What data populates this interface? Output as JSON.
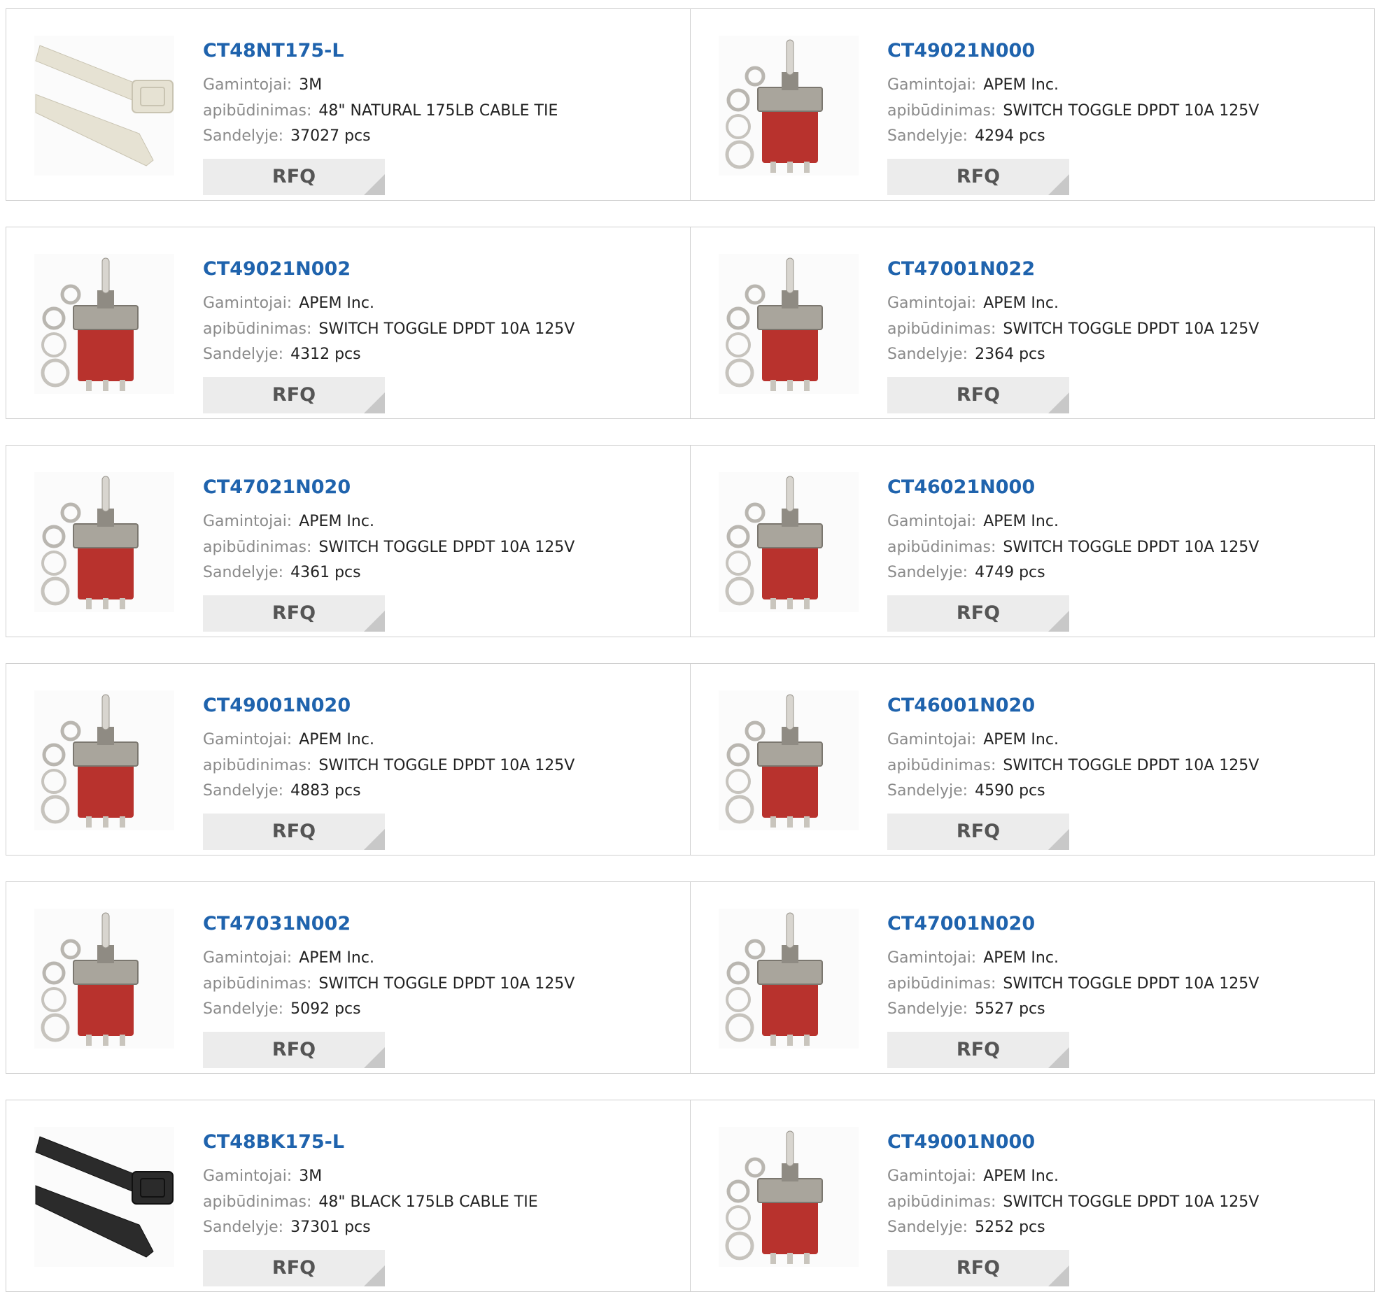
{
  "labels": {
    "manufacturer": "Gamintojai:",
    "description": "apibūdinimas:",
    "stock": "Sandelyje:",
    "rfq": "RFQ"
  },
  "colors": {
    "part_link": "#1f63ad",
    "label": "#8a8a8a",
    "value": "#222222",
    "rfq_bg": "#ececec",
    "rfq_text": "#555555"
  },
  "products": [
    {
      "part": "CT48NT175-L",
      "manufacturer": "3M",
      "description": "48\" NATURAL 175LB CABLE TIE",
      "stock": "37027 pcs",
      "image": "natural-cable-tie-image"
    },
    {
      "part": "CT49021N000",
      "manufacturer": "APEM Inc.",
      "description": "SWITCH TOGGLE DPDT 10A 125V",
      "stock": "4294 pcs",
      "image": "toggle-switch-image"
    },
    {
      "part": "CT49021N002",
      "manufacturer": "APEM Inc.",
      "description": "SWITCH TOGGLE DPDT 10A 125V",
      "stock": "4312 pcs",
      "image": "toggle-switch-image"
    },
    {
      "part": "CT47001N022",
      "manufacturer": "APEM Inc.",
      "description": "SWITCH TOGGLE DPDT 10A 125V",
      "stock": "2364 pcs",
      "image": "toggle-switch-image"
    },
    {
      "part": "CT47021N020",
      "manufacturer": "APEM Inc.",
      "description": "SWITCH TOGGLE DPDT 10A 125V",
      "stock": "4361 pcs",
      "image": "toggle-switch-image"
    },
    {
      "part": "CT46021N000",
      "manufacturer": "APEM Inc.",
      "description": "SWITCH TOGGLE DPDT 10A 125V",
      "stock": "4749 pcs",
      "image": "toggle-switch-image"
    },
    {
      "part": "CT49001N020",
      "manufacturer": "APEM Inc.",
      "description": "SWITCH TOGGLE DPDT 10A 125V",
      "stock": "4883 pcs",
      "image": "toggle-switch-image"
    },
    {
      "part": "CT46001N020",
      "manufacturer": "APEM Inc.",
      "description": "SWITCH TOGGLE DPDT 10A 125V",
      "stock": "4590 pcs",
      "image": "toggle-switch-image"
    },
    {
      "part": "CT47031N002",
      "manufacturer": "APEM Inc.",
      "description": "SWITCH TOGGLE DPDT 10A 125V",
      "stock": "5092 pcs",
      "image": "toggle-switch-image"
    },
    {
      "part": "CT47001N020",
      "manufacturer": "APEM Inc.",
      "description": "SWITCH TOGGLE DPDT 10A 125V",
      "stock": "5527 pcs",
      "image": "toggle-switch-image"
    },
    {
      "part": "CT48BK175-L",
      "manufacturer": "3M",
      "description": "48\" BLACK 175LB CABLE TIE",
      "stock": "37301 pcs",
      "image": "black-cable-tie-image"
    },
    {
      "part": "CT49001N000",
      "manufacturer": "APEM Inc.",
      "description": "SWITCH TOGGLE DPDT 10A 125V",
      "stock": "5252 pcs",
      "image": "toggle-switch-image"
    }
  ]
}
